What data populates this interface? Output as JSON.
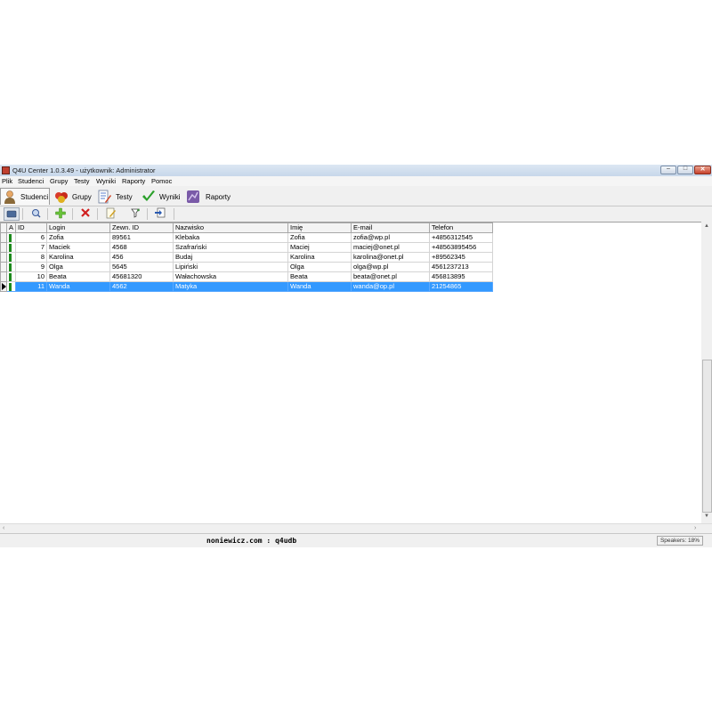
{
  "window": {
    "title": "Q4U Center 1.0.3.49 - użytkownik: Administrator",
    "min_glyph": "‒",
    "max_glyph": "□",
    "close_glyph": "✕"
  },
  "menu": [
    "Plik",
    "Studenci",
    "Grupy",
    "Testy",
    "Wyniki",
    "Raporty",
    "Pomoc"
  ],
  "modules": [
    {
      "label": "Studenci",
      "icon": "user-icon",
      "active": true
    },
    {
      "label": "Grupy",
      "icon": "groups-icon",
      "active": false
    },
    {
      "label": "Testy",
      "icon": "test-icon",
      "active": false
    },
    {
      "label": "Wyniki",
      "icon": "checkmark-icon",
      "active": false
    },
    {
      "label": "Raporty",
      "icon": "reports-icon",
      "active": false
    }
  ],
  "toolbar": [
    "card-icon",
    "search-icon",
    "add-icon",
    "delete-icon",
    "edit-icon",
    "filter-icon",
    "import-icon"
  ],
  "table": {
    "columns": [
      "A",
      "ID",
      "Login",
      "Zewn. ID",
      "Nazwisko",
      "Imię",
      "E-mail",
      "Telefon"
    ],
    "rows": [
      {
        "id": "6",
        "login": "Zofia",
        "ext_id": "89561",
        "surname": "Klebaka",
        "name": "Zofia",
        "email": "zofia@wp.pl",
        "phone": "+4856312545",
        "selected": false
      },
      {
        "id": "7",
        "login": "Maciek",
        "ext_id": "4568",
        "surname": "Szafrański",
        "name": "Maciej",
        "email": "maciej@onet.pl",
        "phone": "+48563895456",
        "selected": false
      },
      {
        "id": "8",
        "login": "Karolina",
        "ext_id": "456",
        "surname": "Budaj",
        "name": "Karolina",
        "email": "karolina@onet.pl",
        "phone": "+89562345",
        "selected": false
      },
      {
        "id": "9",
        "login": "Olga",
        "ext_id": "5645",
        "surname": "Lipiński",
        "name": "Olga",
        "email": "olga@wp.pl",
        "phone": "4561237213",
        "selected": false
      },
      {
        "id": "10",
        "login": "Beata",
        "ext_id": "45681320",
        "surname": "Wałachowska",
        "name": "Beata",
        "email": "beata@onet.pl",
        "phone": "456813895",
        "selected": false
      },
      {
        "id": "11",
        "login": "Wanda",
        "ext_id": "4562",
        "surname": "Matyka",
        "name": "Wanda",
        "email": "wanda@op.pl",
        "phone": "21254865",
        "selected": true
      }
    ]
  },
  "status": {
    "center": "noniewicz.com : q4udb",
    "right": "Speakers: 18%"
  },
  "colors": {
    "selection": "#3399ff",
    "active_indicator": "#1d8a1d"
  }
}
